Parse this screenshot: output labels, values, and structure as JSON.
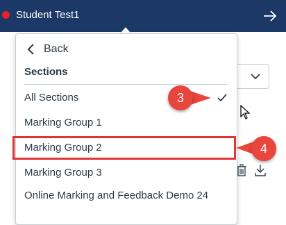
{
  "header": {
    "student_name": "Student Test1",
    "status_color": "#e8202a",
    "background_color": "#1b3866",
    "next_icon": "arrow-right-icon"
  },
  "dropdown": {
    "back_label": "Back",
    "section_heading": "Sections",
    "items": [
      {
        "label": "All Sections",
        "selected": true
      },
      {
        "label": "Marking Group 1",
        "selected": false
      },
      {
        "label": "Marking Group 2",
        "selected": false
      },
      {
        "label": "Marking Group 3",
        "selected": false
      },
      {
        "label": "Online Marking and Feedback Demo 24",
        "selected": false
      }
    ]
  },
  "annotations": {
    "callout_3": "3",
    "callout_4": "4",
    "highlight_color": "#e03535"
  }
}
